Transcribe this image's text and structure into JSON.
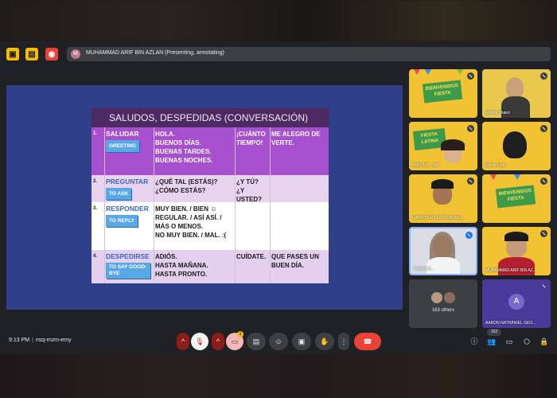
{
  "presenter_bar": {
    "avatar_letter": "M",
    "text": "MUHAMMAD ARIF BIN AZLAN (Presenting, annotating)"
  },
  "slide": {
    "title": "SALUDOS, DESPEDIDAS (CONVERSACIÓN)",
    "rows": [
      {
        "num": "1.",
        "verb": "SALUDAR",
        "tag": "GREETING",
        "col1": [
          "HOLA.",
          "BUENOS DÍAS.",
          "BUENAS TARDES.",
          "BUENAS NOCHES."
        ],
        "col2": [
          "¡CUÁNTO",
          "TIEMPO!"
        ],
        "col3": [
          "ME ALEGRO DE",
          "VERTE."
        ]
      },
      {
        "num": "2.",
        "verb": "PREGUNTAR",
        "tag": "TO ASK",
        "col1": [
          "¿QUÉ TAL (ESTÁS)?",
          "¿CÓMO ESTÁS?"
        ],
        "col2": [
          "¿Y TÚ?",
          "¿Y USTED?"
        ],
        "col3": []
      },
      {
        "num": "3.",
        "verb": "RESPONDER",
        "tag": "TO REPLY",
        "col1": [
          "MUY BIEN. / BIEN ☺",
          "REGULAR. / ASÍ ASÍ. /",
          "MÁS O MENOS.",
          "NO MUY BIEN. / MAL. :("
        ],
        "col2": [],
        "col3": []
      },
      {
        "num": "4.",
        "verb": "DESPEDIRSE",
        "tag": "TO SAY GOOD-BYE",
        "col1": [
          "ADIÓS.",
          "HASTA MAÑANA.",
          "HASTA PRONTO."
        ],
        "col2": [
          "CUÍDATE."
        ],
        "col3": [
          "QUE PASES UN",
          "BUEN DÍA."
        ]
      }
    ]
  },
  "tiles": [
    {
      "name": "",
      "kind": "fiesta"
    },
    {
      "name": "Elysha Shakri",
      "kind": "person"
    },
    {
      "name": "ANIS ATI... (M)",
      "kind": "fiesta-person"
    },
    {
      "name": "Edwin Gobi",
      "kind": "fiesta-person"
    },
    {
      "name": "GAYATHERY A/P SHANMU...",
      "kind": "fiesta-person"
    },
    {
      "name": "",
      "kind": "fiesta"
    },
    {
      "name": "Violetta B...",
      "kind": "camera"
    },
    {
      "name": "MUHAMMAD ARIF BIN AZ...",
      "kind": "fiesta-person"
    }
  ],
  "others_tile": {
    "label": "163 others"
  },
  "aaron_tile": {
    "letter": "A",
    "name": "AARON NATHANIEL GEO..."
  },
  "participants_count": "163",
  "bottom": {
    "time": "9:13 PM",
    "meeting_code": "nsq-rnzm-emy",
    "raised_count": "1"
  },
  "colors": {
    "stage_blue": "#2f3f8a",
    "title_purple": "#4e2a63",
    "row_purple": "#a64fcf",
    "hangup_red": "#ea4335"
  }
}
